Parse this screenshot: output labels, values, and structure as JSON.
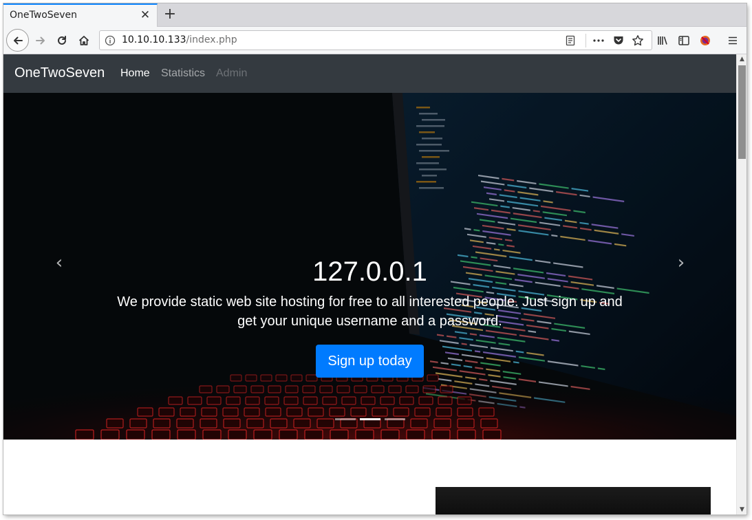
{
  "browser": {
    "tab_title": "OneTwoSeven",
    "tab_close": "✕",
    "new_tab": "+",
    "url_host": "10.10.10.133",
    "url_path": "/index.php"
  },
  "site": {
    "brand": "OneTwoSeven",
    "nav": [
      {
        "label": "Home"
      },
      {
        "label": "Statistics"
      },
      {
        "label": "Admin"
      }
    ]
  },
  "hero": {
    "title": "127.0.0.1",
    "text": "We provide static web site hosting for free to all interested people. Just sign up and get your unique username and a password.",
    "button": "Sign up today",
    "prev_glyph": "‹",
    "next_glyph": "›",
    "indicators": 3,
    "active_indicator": 1
  },
  "colors": {
    "accent": "#007bff",
    "navbar": "#343a40",
    "tab_highlight": "#0a84ff"
  },
  "icons": [
    "back-icon",
    "forward-icon",
    "reload-icon",
    "home-icon",
    "info-icon",
    "reader-icon",
    "more-icon",
    "pocket-icon",
    "star-icon",
    "library-icon",
    "sidebar-icon",
    "block-icon",
    "menu-icon"
  ]
}
